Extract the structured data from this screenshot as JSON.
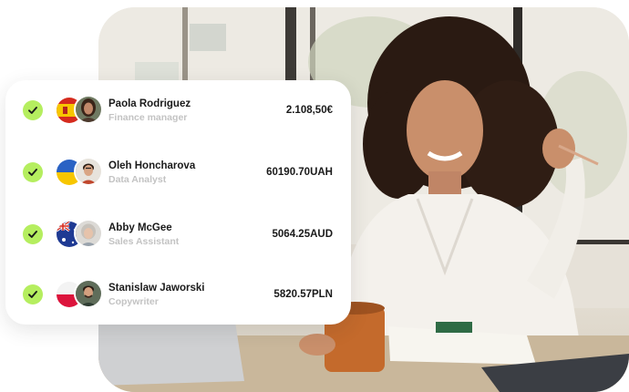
{
  "payments": [
    {
      "name": "Paola Rodriguez",
      "role": "Finance manager",
      "amount": "2.108,50€",
      "flag": "spain-flag",
      "status": "paid-check-icon"
    },
    {
      "name": "Oleh Honcharova",
      "role": "Data Analyst",
      "amount": "60190.70UAH",
      "flag": "ukraine-flag",
      "status": "paid-check-icon"
    },
    {
      "name": "Abby McGee",
      "role": "Sales Assistant",
      "amount": "5064.25AUD",
      "flag": "australia-flag",
      "status": "paid-check-icon"
    },
    {
      "name": "Stanislaw Jaworski",
      "role": "Copywriter",
      "amount": "5820.57PLN",
      "flag": "poland-flag",
      "status": "paid-check-icon"
    }
  ],
  "colors": {
    "check": "#b5ee5f",
    "text": "#1a1a1a",
    "muted": "#c3c3c3"
  }
}
